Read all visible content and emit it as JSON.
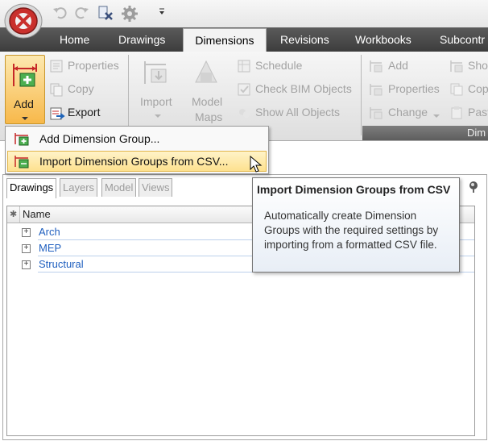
{
  "tabs": [
    "Home",
    "Drawings",
    "Dimensions",
    "Revisions",
    "Workbooks",
    "Subcontr"
  ],
  "ribbon": {
    "add_label": "Add",
    "properties": "Properties",
    "copy": "Copy",
    "export": "Export",
    "import": "Import",
    "model_maps_line1": "Model",
    "model_maps_line2": "Maps",
    "schedule": "Schedule",
    "check_bim": "Check BIM Objects",
    "show_all": "Show All Objects",
    "add2": "Add",
    "properties2": "Properties",
    "change": "Change",
    "show_trunc": "Sho",
    "copy_trunc": "Cop",
    "paste_trunc": "Past",
    "group_footer": "Dim"
  },
  "menu": {
    "add_group": "Add Dimension Group...",
    "import_csv": "Import Dimension Groups from CSV..."
  },
  "panel": {
    "tabs": [
      "Drawings",
      "Layers",
      "Model",
      "Views"
    ],
    "header_name": "Name",
    "rows": [
      "Arch",
      "MEP",
      "Structural"
    ]
  },
  "tooltip": {
    "title": "Import Dimension Groups from CSV",
    "body": "Automatically create Dimension Groups with the required settings by importing from a formatted CSV file."
  },
  "colors": {
    "accent_orange": "#f7b84a",
    "tab_strip": "#4a4a4a",
    "tree_link": "#1f5fbf"
  }
}
